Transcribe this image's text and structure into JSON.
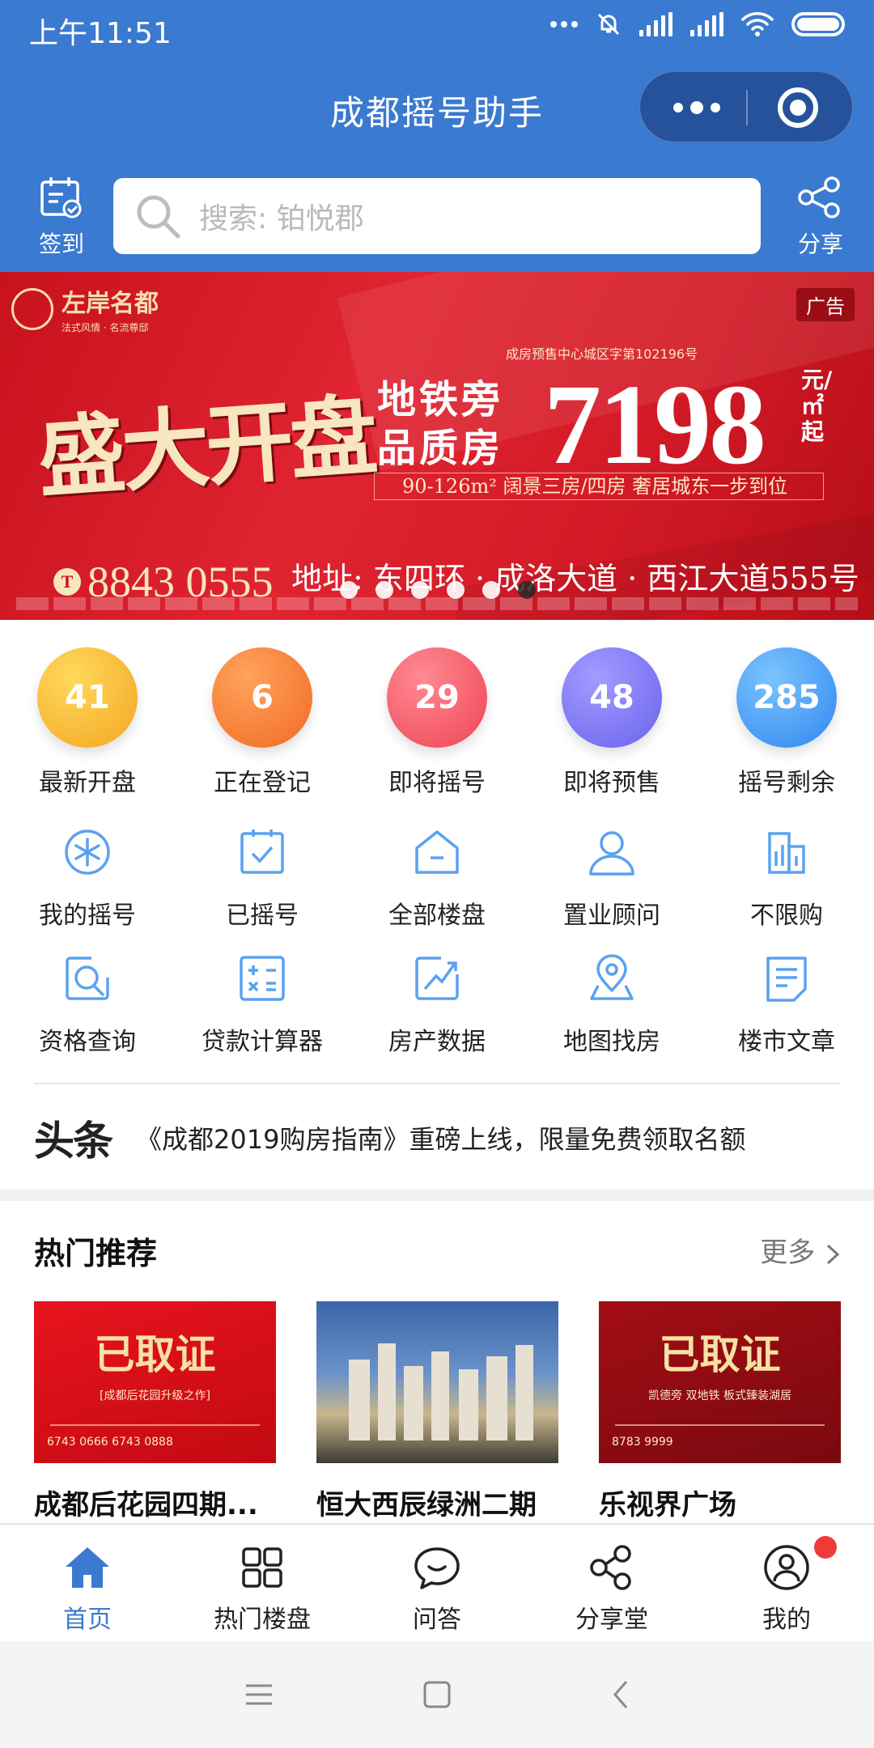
{
  "status_bar": {
    "time": "上午11:51"
  },
  "titlebar": {
    "title": "成都摇号助手"
  },
  "header": {
    "signin_label": "签到",
    "search_placeholder": "搜索: 铂悦郡",
    "share_label": "分享"
  },
  "banner": {
    "ad_badge": "广告",
    "brand_name": "左岸名都",
    "brand_sub": "法式风情 · 名流尊邸",
    "permit": "成房预售中心城区字第102196号",
    "headline": "盛大开盘",
    "tag_1": "地铁旁",
    "tag_2": "品质房",
    "price": "7198",
    "price_unit": "元/㎡起",
    "features": "90-126m² 阔景三房/四房  奢居城东一步到位",
    "phone": "8843 0555",
    "address": "地址: 东四环 · 成洛大道 · 西江大道555号",
    "slide_count": 6,
    "active_slide": 6
  },
  "stats": [
    {
      "value": "41",
      "label": "最新开盘",
      "color": "#f7b52c"
    },
    {
      "value": "6",
      "label": "正在登记",
      "color": "#f7772c"
    },
    {
      "value": "29",
      "label": "即将摇号",
      "color": "#f45463"
    },
    {
      "value": "48",
      "label": "即将预售",
      "color": "#7b72f3"
    },
    {
      "value": "285",
      "label": "摇号剩余",
      "color": "#3d97f2"
    }
  ],
  "grid_row_1": [
    {
      "label": "我的摇号",
      "icon": "snowflake-icon"
    },
    {
      "label": "已摇号",
      "icon": "checklist-icon"
    },
    {
      "label": "全部楼盘",
      "icon": "house-icon"
    },
    {
      "label": "置业顾问",
      "icon": "person-icon"
    },
    {
      "label": "不限购",
      "icon": "buildings-icon"
    }
  ],
  "grid_row_2": [
    {
      "label": "资格查询",
      "icon": "search-doc-icon"
    },
    {
      "label": "贷款计算器",
      "icon": "calculator-icon"
    },
    {
      "label": "房产数据",
      "icon": "trend-chart-icon"
    },
    {
      "label": "地图找房",
      "icon": "map-pin-icon"
    },
    {
      "label": "楼市文章",
      "icon": "article-icon"
    }
  ],
  "news": {
    "source_logo": "头条",
    "headline": "《成都2019购房指南》重磅上线，限量免费领取名额"
  },
  "hot": {
    "title": "热门推荐",
    "more": "更多",
    "cards": [
      {
        "name": "成都后花园四期...",
        "cert": "已取证",
        "cert_sub": "[成都后花园升级之作]",
        "phone": "6743 0666  6743 0888"
      },
      {
        "name": "恒大西辰绿洲二期"
      },
      {
        "name": "乐视界广场",
        "cert": "已取证",
        "cert_sub": "凯德旁 双地铁 板式臻装湖居",
        "phone": "8783 9999"
      }
    ]
  },
  "tabbar": [
    {
      "label": "首页",
      "icon": "home-icon",
      "active": true
    },
    {
      "label": "热门楼盘",
      "icon": "grid-icon"
    },
    {
      "label": "问答",
      "icon": "chat-icon"
    },
    {
      "label": "分享堂",
      "icon": "share-icon"
    },
    {
      "label": "我的",
      "icon": "profile-icon",
      "badge": true
    }
  ],
  "colors": {
    "primary": "#3a7ad0",
    "icon_blue": "#5aa2f0",
    "banner_red": "#d31a27"
  }
}
